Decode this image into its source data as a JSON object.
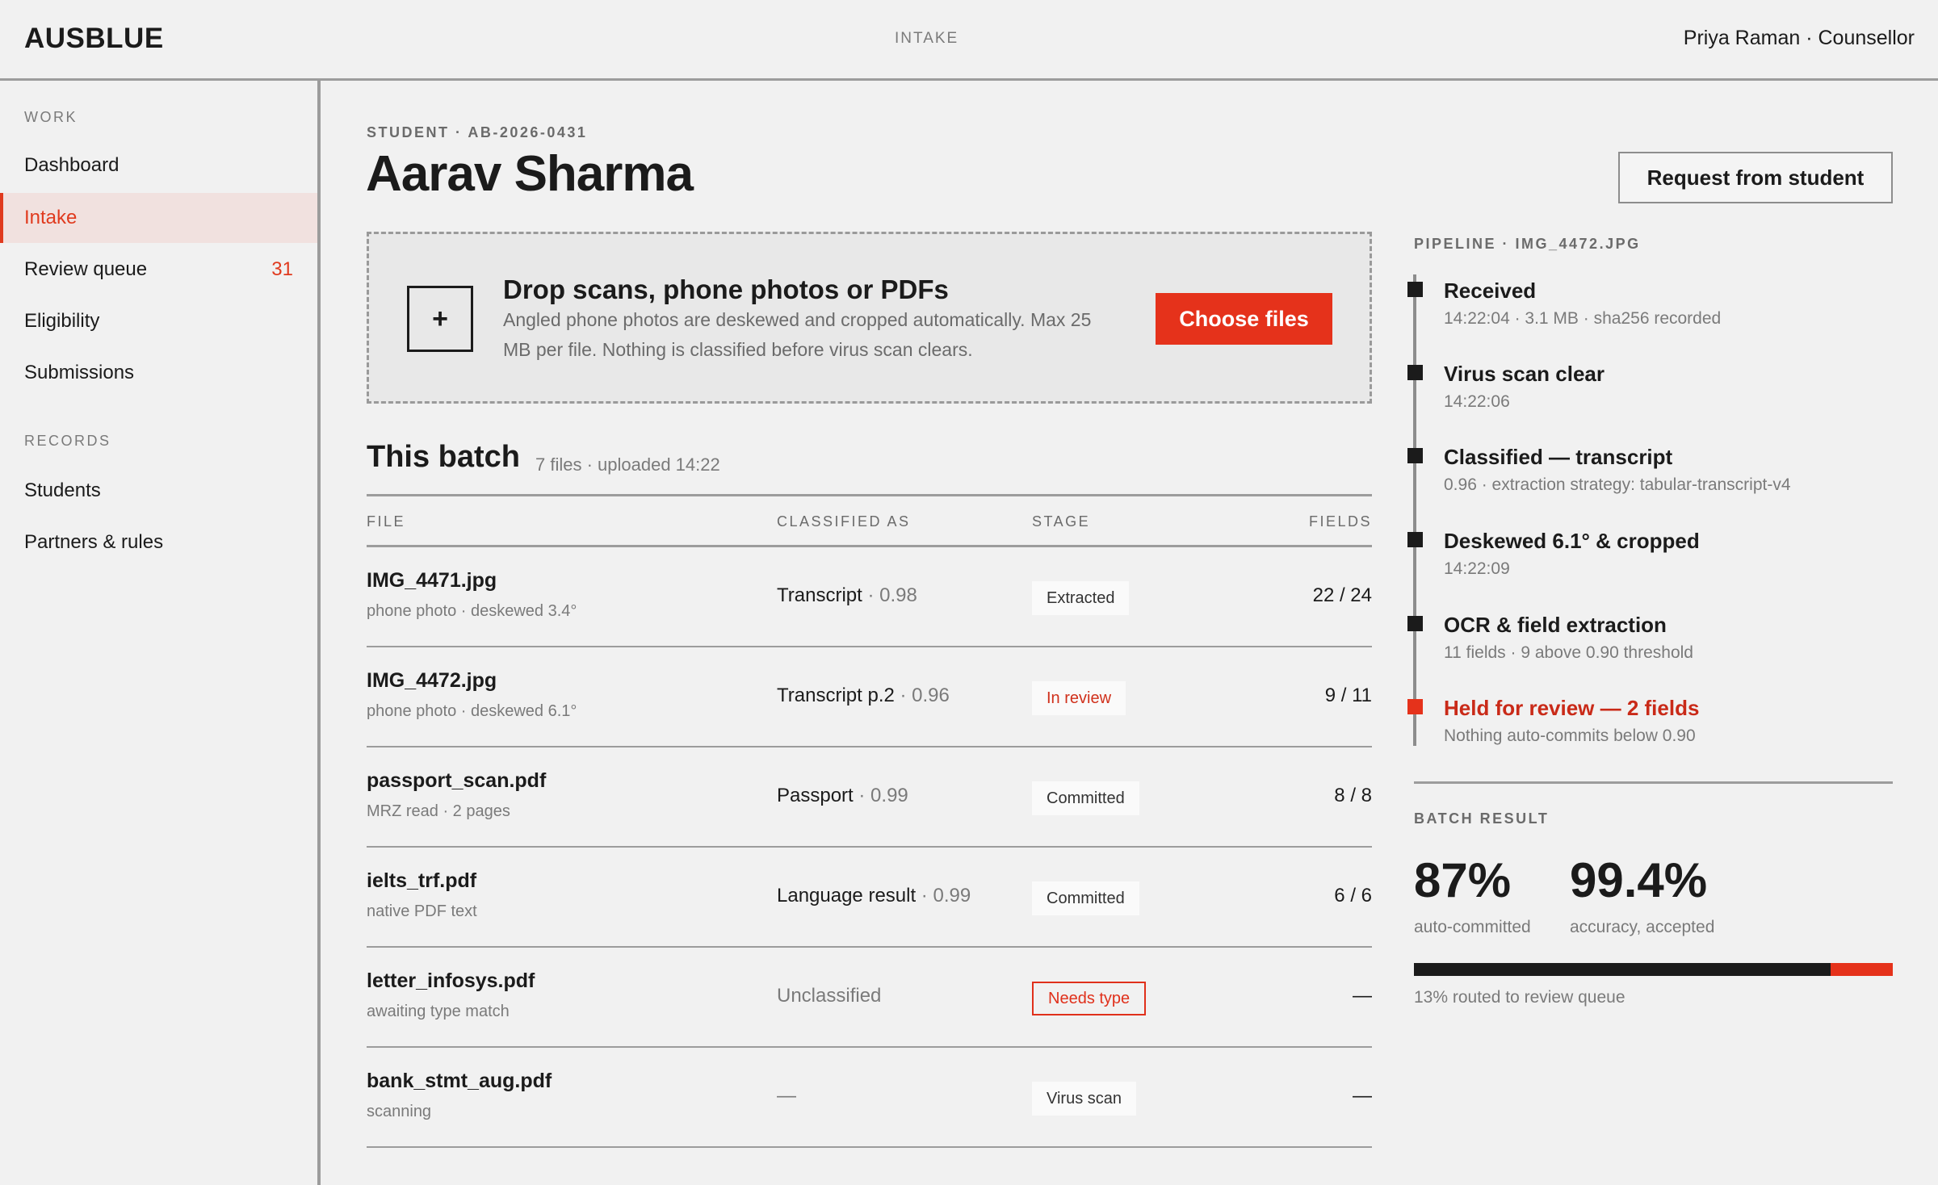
{
  "header": {
    "brand": "AUSBLUE",
    "section": "INTAKE",
    "user": "Priya Raman · Counsellor"
  },
  "sidebar": {
    "work_heading": "WORK",
    "work_items": [
      {
        "label": "Dashboard"
      },
      {
        "label": "Intake",
        "active": true
      },
      {
        "label": "Review queue",
        "count": "31"
      },
      {
        "label": "Eligibility"
      },
      {
        "label": "Submissions"
      }
    ],
    "records_heading": "RECORDS",
    "records_items": [
      {
        "label": "Students"
      },
      {
        "label": "Partners & rules"
      }
    ]
  },
  "student": {
    "eyebrow": "STUDENT · AB-2026-0431",
    "name": "Aarav Sharma",
    "request_button": "Request from student"
  },
  "dropzone": {
    "plus": "+",
    "title": "Drop scans, phone photos or PDFs",
    "description": "Angled phone photos are deskewed and cropped automatically. Max 25 MB per file. Nothing is classified before virus scan clears.",
    "button": "Choose files"
  },
  "batch": {
    "title": "This batch",
    "meta": "7 files · uploaded 14:22",
    "columns": [
      "FILE",
      "CLASSIFIED AS",
      "STAGE",
      "FIELDS"
    ],
    "rows": [
      {
        "file": "IMG_4471.jpg",
        "sub": "phone photo · deskewed 3.4°",
        "cls": "Transcript",
        "conf": " · 0.98",
        "stage": "Extracted",
        "stage_kind": "plain",
        "fields": "22 / 24"
      },
      {
        "file": "IMG_4472.jpg",
        "sub": "phone photo · deskewed 6.1°",
        "cls": "Transcript p.2",
        "conf": " · 0.96",
        "stage": "In review",
        "stage_kind": "review",
        "fields": "9 / 11"
      },
      {
        "file": "passport_scan.pdf",
        "sub": "MRZ read · 2 pages",
        "cls": "Passport",
        "conf": " · 0.99",
        "stage": "Committed",
        "stage_kind": "plain",
        "fields": "8 / 8"
      },
      {
        "file": "ielts_trf.pdf",
        "sub": "native PDF text",
        "cls": "Language result",
        "conf": " · 0.99",
        "stage": "Committed",
        "stage_kind": "plain",
        "fields": "6 / 6"
      },
      {
        "file": "letter_infosys.pdf",
        "sub": "awaiting type match",
        "cls": "Unclassified",
        "conf": "",
        "stage": "Needs type",
        "stage_kind": "needs",
        "fields": "—"
      },
      {
        "file": "bank_stmt_aug.pdf",
        "sub": "scanning",
        "cls": "—",
        "conf": "",
        "stage": "Virus scan",
        "stage_kind": "plain",
        "fields": "—"
      }
    ]
  },
  "pipeline": {
    "heading": "PIPELINE · IMG_4472.JPG",
    "steps": [
      {
        "title": "Received",
        "sub": "14:22:04 · 3.1 MB · sha256 recorded"
      },
      {
        "title": "Virus scan clear",
        "sub": "14:22:06"
      },
      {
        "title": "Classified — transcript",
        "sub": "0.96 · extraction strategy: tabular-transcript-v4"
      },
      {
        "title": "Deskewed 6.1° & cropped",
        "sub": "14:22:09"
      },
      {
        "title": "OCR & field extraction",
        "sub": "11 fields · 9 above 0.90 threshold"
      },
      {
        "title": "Held for review — 2 fields",
        "sub": "Nothing auto-commits below 0.90",
        "alert": true
      }
    ]
  },
  "batch_result": {
    "heading": "BATCH RESULT",
    "auto_value": "87%",
    "auto_label": "auto-committed",
    "acc_value": "99.4%",
    "acc_label": "accuracy, accepted",
    "auto_fraction": 0.87,
    "note": "13% routed to review queue"
  },
  "colors": {
    "accent": "#e5321b",
    "ink": "#1b1b1b",
    "background": "#f1f1f1"
  }
}
